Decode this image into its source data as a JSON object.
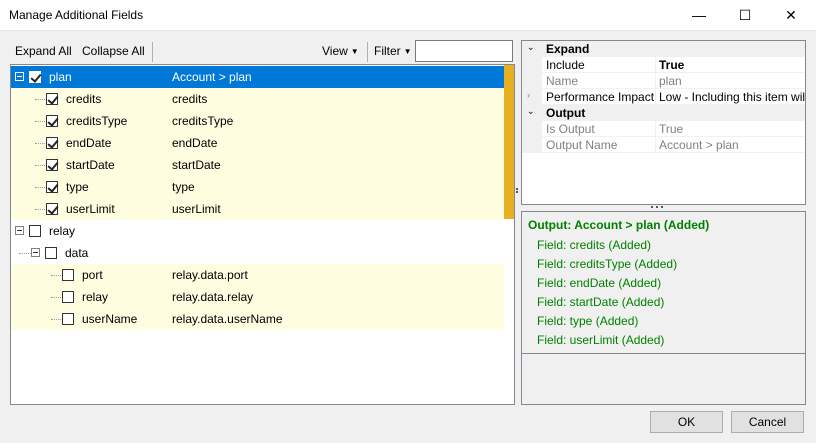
{
  "window": {
    "title": "Manage Additional Fields",
    "minimize": "—",
    "maximize": "☐",
    "close": "✕"
  },
  "toolbar": {
    "expand_all": "Expand All",
    "collapse_all": "Collapse All",
    "view": "View",
    "filter": "Filter",
    "filter_value": ""
  },
  "tree": {
    "plan": {
      "name": "plan",
      "value": "Account > plan",
      "checked": true
    },
    "plan_children": [
      {
        "name": "credits",
        "value": "credits"
      },
      {
        "name": "creditsType",
        "value": "creditsType"
      },
      {
        "name": "endDate",
        "value": "endDate"
      },
      {
        "name": "startDate",
        "value": "startDate"
      },
      {
        "name": "type",
        "value": "type"
      },
      {
        "name": "userLimit",
        "value": "userLimit"
      }
    ],
    "relay": {
      "name": "relay"
    },
    "data": {
      "name": "data"
    },
    "data_children": [
      {
        "name": "port",
        "value": "relay.data.port"
      },
      {
        "name": "relay",
        "value": "relay.data.relay"
      },
      {
        "name": "userName",
        "value": "relay.data.userName"
      }
    ]
  },
  "properties": {
    "expand_category": "Expand",
    "include_name": "Include",
    "include_value": "True",
    "name_name": "Name",
    "name_value": "plan",
    "impact_name": "Performance Impact",
    "impact_value": "Low - Including this item will have",
    "output_category": "Output",
    "is_output_name": "Is Output",
    "is_output_value": "True",
    "output_name_name": "Output Name",
    "output_name_value": "Account > plan"
  },
  "output": {
    "head": "Output: Account > plan (Added)",
    "lines": [
      "Field: credits (Added)",
      "Field: creditsType (Added)",
      "Field: endDate (Added)",
      "Field: startDate (Added)",
      "Field: type (Added)",
      "Field: userLimit (Added)"
    ]
  },
  "buttons": {
    "ok": "OK",
    "cancel": "Cancel"
  },
  "colors": {
    "selection": "#0078d7",
    "row_highlight": "#fffde0",
    "output_text": "#008000",
    "scroll_marker": "#e6b020"
  }
}
